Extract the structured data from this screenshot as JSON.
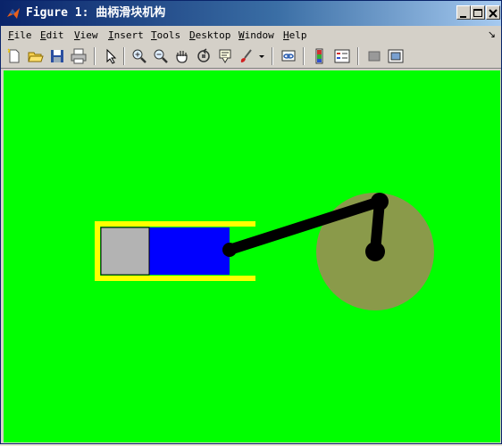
{
  "window": {
    "title": "Figure 1: 曲柄滑块机构",
    "icon": "matlab-logo-icon",
    "controls": [
      "minimize-icon",
      "maximize-icon",
      "close-icon"
    ]
  },
  "menu": {
    "items": [
      {
        "key": "file",
        "ul": "F",
        "rest": "ile"
      },
      {
        "key": "edit",
        "ul": "E",
        "rest": "dit"
      },
      {
        "key": "view",
        "ul": "V",
        "rest": "iew"
      },
      {
        "key": "insert",
        "ul": "I",
        "rest": "nsert"
      },
      {
        "key": "tools",
        "ul": "T",
        "rest": "ools"
      },
      {
        "key": "desktop",
        "ul": "D",
        "rest": "esktop"
      },
      {
        "key": "window",
        "ul": "W",
        "rest": "indow"
      },
      {
        "key": "help",
        "ul": "H",
        "rest": "elp"
      }
    ],
    "overflow_glyph": "↘"
  },
  "toolbar": {
    "buttons": [
      "new-figure-icon",
      "open-file-icon",
      "save-icon",
      "print-icon",
      "edit-plot-arrow-icon",
      "zoom-in-icon",
      "zoom-out-icon",
      "pan-hand-icon",
      "rotate-3d-icon",
      "data-cursor-icon",
      "brush-icon",
      "brush-dropdown-icon",
      "link-plot-icon",
      "colorbar-icon",
      "legend-icon",
      "hide-plot-tools-icon",
      "show-plot-tools-icon"
    ]
  },
  "colors": {
    "plot_background": "#00ff00",
    "cylinder_outline": "#ffff00",
    "slider_block": "#b3b3b3",
    "gas_chamber": "#0000ff",
    "crank_disk": "#8a9a4a",
    "links": "#000000"
  }
}
